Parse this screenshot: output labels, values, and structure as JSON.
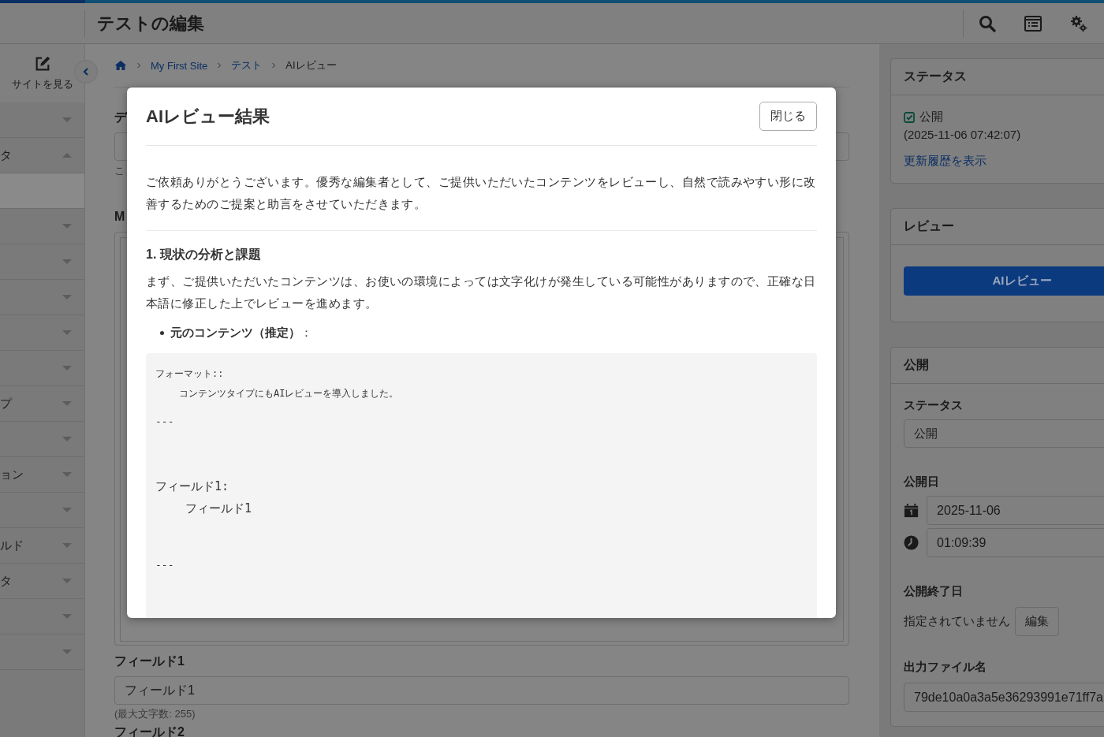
{
  "header": {
    "title": "テストの編集"
  },
  "sidebar": {
    "view_site": "サイトを見る",
    "items": [
      {
        "kind": "group",
        "expanded": false,
        "selected": false
      },
      {
        "kind": "group",
        "label": "タ",
        "expanded": true,
        "selected": false
      },
      {
        "kind": "sub",
        "selected": true
      },
      {
        "kind": "group",
        "expanded": false,
        "selected": false
      },
      {
        "kind": "group",
        "expanded": false,
        "selected": false
      },
      {
        "kind": "group",
        "expanded": false,
        "selected": false
      },
      {
        "kind": "group",
        "expanded": false,
        "selected": false
      },
      {
        "kind": "group",
        "expanded": false,
        "selected": false
      },
      {
        "kind": "group",
        "label": "プ",
        "expanded": false,
        "selected": false
      },
      {
        "kind": "group",
        "expanded": false,
        "selected": false
      },
      {
        "kind": "group",
        "label": "ョン",
        "expanded": false,
        "selected": false
      },
      {
        "kind": "group",
        "expanded": false,
        "selected": false
      },
      {
        "kind": "group",
        "label": "ルド",
        "expanded": false,
        "selected": false
      },
      {
        "kind": "group",
        "label": "タ",
        "expanded": false,
        "selected": false
      },
      {
        "kind": "group",
        "expanded": false,
        "selected": false
      },
      {
        "kind": "group",
        "expanded": false,
        "selected": false
      }
    ]
  },
  "breadcrumb": [
    {
      "kind": "home"
    },
    {
      "kind": "link",
      "text": "My First Site"
    },
    {
      "kind": "link",
      "text": "テスト"
    },
    {
      "kind": "current",
      "text": "AIレビュー"
    }
  ],
  "main": {
    "label_partial": "デ",
    "hint_partial": "こ",
    "area_label_partial": "M",
    "field1": {
      "label": "フィールド1",
      "value": "フィールド1",
      "hint": "(最大文字数: 255)"
    },
    "field2_label": "フィールド2"
  },
  "status_card": {
    "title": "ステータス",
    "checked": true,
    "state": "公開",
    "date": "(2025-11-06 07:42:07)",
    "link": "更新履歴を表示"
  },
  "review_card": {
    "title": "レビュー",
    "button": "AIレビュー"
  },
  "publish_card": {
    "title": "公開",
    "status_label": "ステータス",
    "status_value": "公開",
    "date_label": "公開日",
    "date": "2025-11-06",
    "time": "01:09:39",
    "end_label": "公開終了日",
    "end_value": "指定されていません",
    "end_button": "編集",
    "file_label": "出力ファイル名",
    "file_value": "79de10a0a3a5e36293991e71ff7a"
  },
  "modal": {
    "title": "AIレビュー結果",
    "close": "閉じる",
    "intro": "ご依頼ありがとうございます。優秀な編集者として、ご提供いただいたコンテンツをレビューし、自然で読みやすい形に改善するためのご提案と助言をさせていただきます。",
    "heading": "1. 現状の分析と課題",
    "paragraph": "まず、ご提供いただいたコンテンツは、お使いの環境によっては文字化けが発生している可能性がありますので、正確な日本語に修正した上でレビューを進めます。",
    "bullets": [
      "**元のコンテンツ（推定）**："
    ],
    "code_lines": [
      {
        "kind": "small",
        "text": "フォーマット::"
      },
      {
        "kind": "small-indent",
        "text": "コンテンツタイプにもAIレビューを導入しました。"
      },
      {
        "kind": "rule",
        "text": "---"
      },
      {
        "kind": "large",
        "text": "フィールド1:"
      },
      {
        "kind": "large-indent",
        "text": "フィールド1"
      },
      {
        "kind": "rule",
        "text": "---"
      }
    ]
  }
}
